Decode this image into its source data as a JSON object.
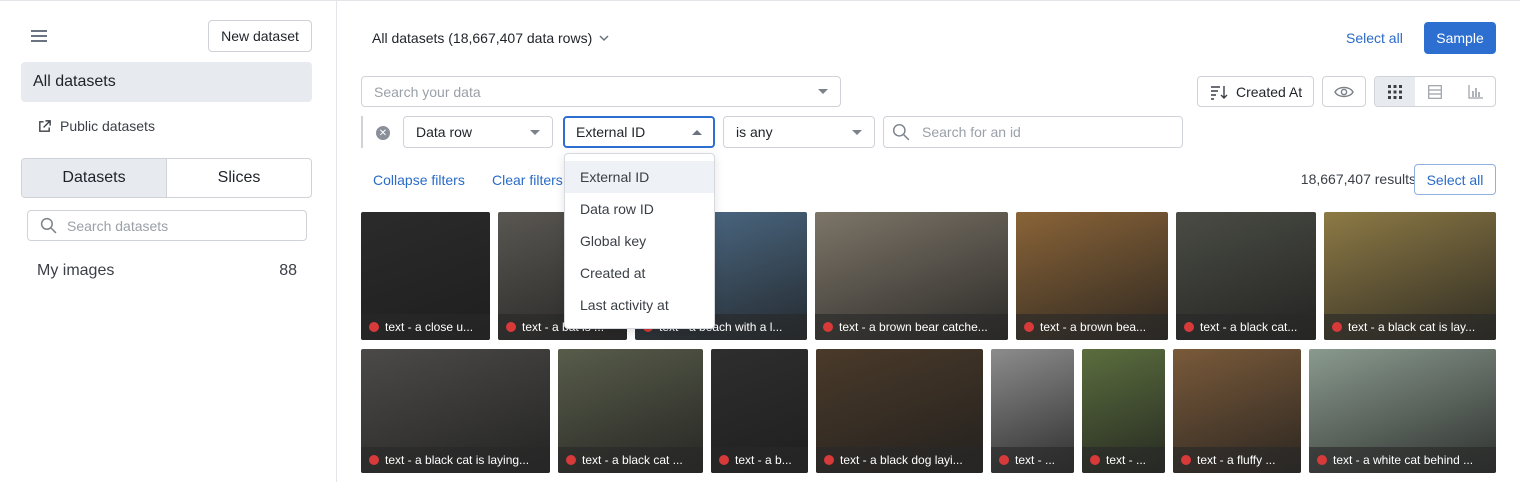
{
  "sidebar": {
    "new_dataset": "New dataset",
    "all_datasets": "All datasets",
    "public_datasets": "Public datasets",
    "tabs": [
      "Datasets",
      "Slices"
    ],
    "search_placeholder": "Search datasets",
    "my_images": {
      "label": "My images",
      "count": "88"
    }
  },
  "header": {
    "title": "All datasets (18,667,407 data rows)",
    "select_all": "Select all",
    "sample": "Sample"
  },
  "search": {
    "placeholder": "Search your data"
  },
  "filter": {
    "field": "Data row",
    "attribute": "External ID",
    "operator": "is any",
    "id_placeholder": "Search for an id",
    "options": [
      "External ID",
      "Data row ID",
      "Global key",
      "Created at",
      "Last activity at"
    ]
  },
  "toolbar": {
    "sort": "Created At"
  },
  "actions": {
    "collapse": "Collapse filters",
    "clear": "Clear filters",
    "results": "18,667,407 results",
    "select_all": "Select all"
  },
  "tiles": [
    {
      "caption": "text - a close u...",
      "color": "#2b2b2b"
    },
    {
      "caption": "text - a bat is ...",
      "color": "#5a5752"
    },
    {
      "caption": "text - a beach with a l...",
      "color": "#4f6f8c"
    },
    {
      "caption": "text - a brown bear catche...",
      "color": "#7d7568"
    },
    {
      "caption": "text - a brown bea...",
      "color": "#8a6438"
    },
    {
      "caption": "text - a black cat...",
      "color": "#4a4c44"
    },
    {
      "caption": "text - a black cat is lay...",
      "color": "#8d7a45"
    },
    {
      "caption": "text - a black cat is laying...",
      "color": "#4b4a48"
    },
    {
      "caption": "text - a black cat ...",
      "color": "#585c4a"
    },
    {
      "caption": "text - a b...",
      "color": "#2e2e2e"
    },
    {
      "caption": "text - a black dog layi...",
      "color": "#4a3a2a"
    },
    {
      "caption": "text - ...",
      "color": "#8c8c8c"
    },
    {
      "caption": "text - ...",
      "color": "#5b6e3e"
    },
    {
      "caption": "text - a fluffy ...",
      "color": "#7a5a3a"
    },
    {
      "caption": "text - a white cat behind ...",
      "color": "#8a9a8e"
    }
  ],
  "colors": {
    "accent": "#2d6fd0",
    "status_dot": "#d83a3a"
  }
}
